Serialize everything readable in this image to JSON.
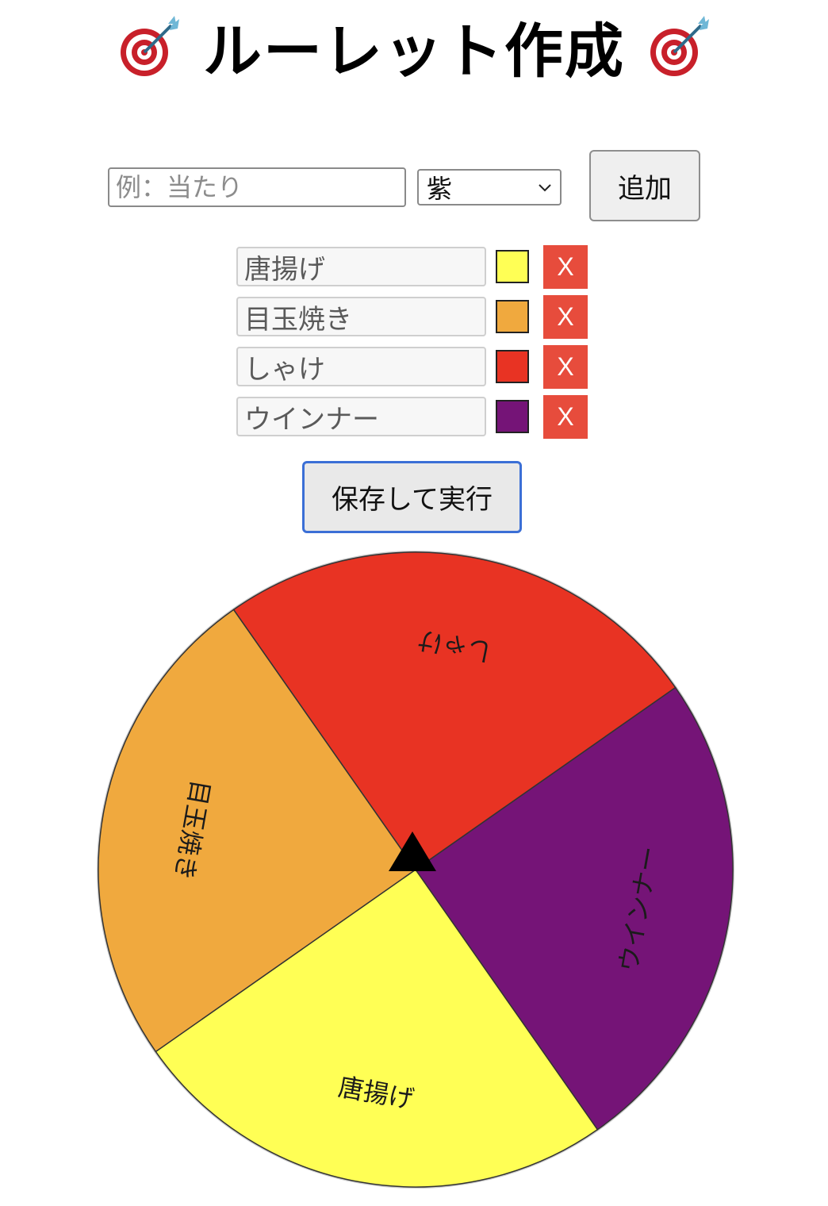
{
  "header": {
    "title": "ルーレット作成",
    "left_icon": "dart-target-icon",
    "right_icon": "dart-target-icon"
  },
  "add_form": {
    "name_placeholder": "例：当たり",
    "name_value": "",
    "color_selected": "紫",
    "add_label": "追加"
  },
  "items": [
    {
      "name": "唐揚げ",
      "color": "#ffff55",
      "delete_label": "X"
    },
    {
      "name": "目玉焼き",
      "color": "#f0a93e",
      "delete_label": "X"
    },
    {
      "name": "しゃけ",
      "color": "#e83323",
      "delete_label": "X"
    },
    {
      "name": "ウインナー",
      "color": "#751477",
      "delete_label": "X"
    }
  ],
  "actions": {
    "run_label": "保存して実行"
  },
  "wheel": {
    "segments": [
      {
        "label": "唐揚げ",
        "color": "#ffff55"
      },
      {
        "label": "目玉焼き",
        "color": "#f0a93e"
      },
      {
        "label": "しゃけ",
        "color": "#e83323"
      },
      {
        "label": "ウインナー",
        "color": "#751477"
      }
    ],
    "pointer_icon": "triangle-pointer-icon",
    "rotation_deg": 55
  },
  "colors": {
    "delete": "#e74c3c",
    "run_border": "#3b6fd6"
  }
}
